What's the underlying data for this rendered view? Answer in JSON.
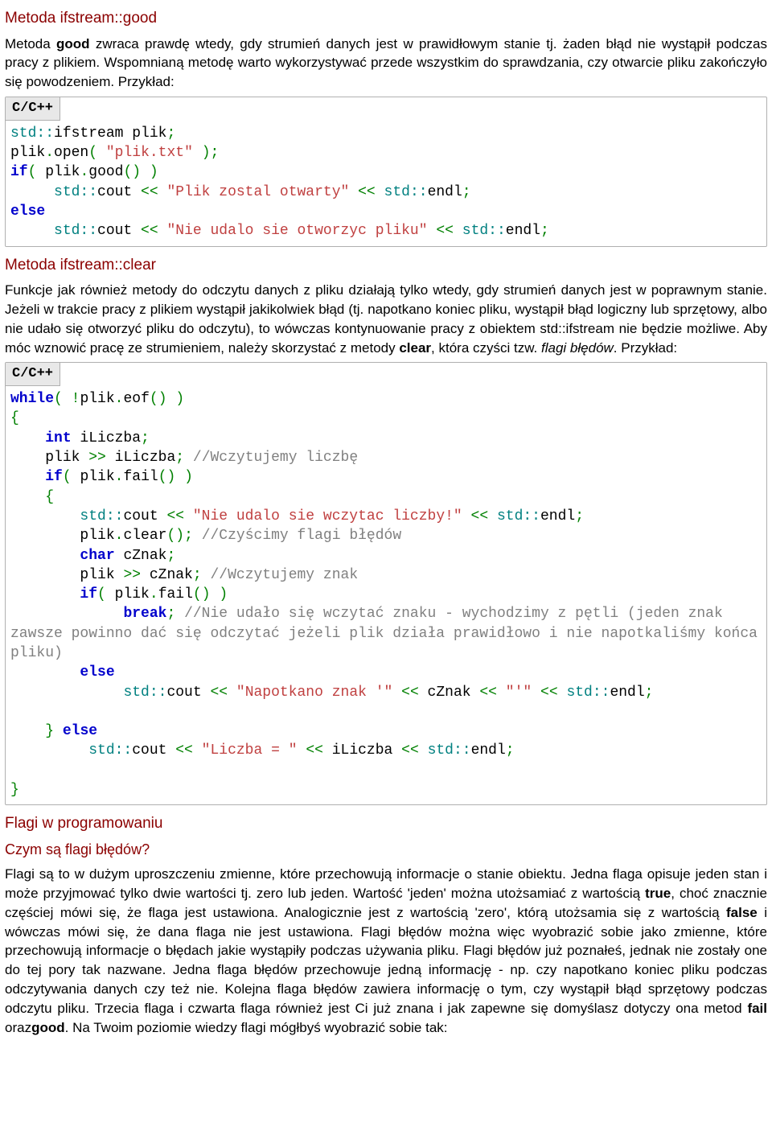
{
  "sections": {
    "good": {
      "heading": "Metoda ifstream::good",
      "para_pre": "Metoda ",
      "bold1": "good",
      "para_post": " zwraca prawdę wtedy, gdy strumień danych jest w prawidłowym stanie tj. żaden błąd nie wystąpił podczas pracy z plikiem. Wspomnianą metodę warto wykorzystywać przede wszystkim do sprawdzania, czy otwarcie pliku zakończyło się powodzeniem. Przykład:",
      "codelabel": "C/C++"
    },
    "clear": {
      "heading": "Metoda ifstream::clear",
      "para_pre": "Funkcje jak również metody do odczytu danych z pliku działają tylko wtedy, gdy strumień danych jest w poprawnym stanie. Jeżeli w trakcie pracy z plikiem wystąpił jakikolwiek błąd (tj. napotkano koniec pliku, wystąpił błąd logiczny lub sprzętowy, albo nie udało się otworzyć pliku do odczytu), to wówczas kontynuowanie pracy z obiektem std::ifstream nie będzie możliwe. Aby móc wznowić pracę ze strumieniem, należy skorzystać z metody ",
      "bold1": "clear",
      "para_mid": ", która czyści tzw. ",
      "ital1": "flagi błędów",
      "para_post": ". Przykład:",
      "codelabel": "C/C++"
    },
    "flags": {
      "heading1": "Flagi w programowaniu",
      "heading2": "Czym są flagi błędów?",
      "para_pre": "Flagi są to w dużym uproszczeniu zmienne, które przechowują informacje o stanie obiektu. Jedna flaga opisuje jeden stan i może przyjmować tylko dwie wartości tj. zero lub jeden. Wartość 'jeden' można utożsamiać z wartością ",
      "bold1": "true",
      "para_mid1": ", choć znacznie częściej mówi się, że flaga jest ustawiona. Analogicznie jest z wartością 'zero', którą utożsamia się z wartością ",
      "bold2": "false",
      "para_mid2": " i wówczas mówi się, że dana flaga nie jest ustawiona. Flagi błędów można więc wyobrazić sobie jako zmienne, które przechowują informacje o błędach jakie wystąpiły podczas używania pliku. Flagi błędów już poznałeś, jednak nie zostały one do tej pory tak nazwane. Jedna flaga błędów przechowuje jedną informację - np. czy napotkano koniec pliku podczas odczytywania danych czy też nie. Kolejna flaga błędów zawiera informację o tym, czy wystąpił błąd sprzętowy podczas odczytu pliku. Trzecia flaga i czwarta flaga również jest Ci już znana i jak zapewne się domyślasz dotyczy ona metod ",
      "bold3": "fail",
      "para_mid3": " oraz",
      "bold4": "good",
      "para_post": ". Na Twoim poziomie wiedzy flagi mógłbyś wyobrazić sobie tak:"
    }
  },
  "code1": {
    "l1_ns": "std",
    "l1_op1": "::",
    "l1_id1": "ifstream plik",
    "l1_p1": ";",
    "l2_id1": "plik",
    "l2_p1": ".",
    "l2_id2": "open",
    "l2_p2": "(",
    "l2_sp": " ",
    "l2_str": "\"plik.txt\"",
    "l2_sp2": " ",
    "l2_p3": ")",
    "l2_p4": ";",
    "l3_kw": "if",
    "l3_p1": "(",
    "l3_sp": " ",
    "l3_id1": "plik",
    "l3_p2": ".",
    "l3_id2": "good",
    "l3_p3": "()",
    "l3_sp2": " ",
    "l3_p4": ")",
    "l4_sp": "     ",
    "l4_ns": "std",
    "l4_op": "::",
    "l4_id1": "cout ",
    "l4_p1": "<<",
    "l4_sp2": " ",
    "l4_str": "\"Plik zostal otwarty\"",
    "l4_sp3": " ",
    "l4_p2": "<<",
    "l4_sp4": " ",
    "l4_ns2": "std",
    "l4_op2": "::",
    "l4_id2": "endl",
    "l4_p3": ";",
    "l5_kw": "else",
    "l6_sp": "     ",
    "l6_ns": "std",
    "l6_op": "::",
    "l6_id1": "cout ",
    "l6_p1": "<<",
    "l6_sp2": " ",
    "l6_str": "\"Nie udalo sie otworzyc pliku\"",
    "l6_sp3": " ",
    "l6_p2": "<<",
    "l6_sp4": " ",
    "l6_ns2": "std",
    "l6_op2": "::",
    "l6_id2": "endl",
    "l6_p3": ";"
  },
  "code2": {
    "l1_kw": "while",
    "l1_p1": "(",
    "l1_sp": " ",
    "l1_p2": "!",
    "l1_id1": "plik",
    "l1_p3": ".",
    "l1_id2": "eof",
    "l1_p4": "()",
    "l1_sp2": " ",
    "l1_p5": ")",
    "l2_p1": "{",
    "l3_sp": "    ",
    "l3_kw": "int",
    "l3_id": " iLiczba",
    "l3_p1": ";",
    "l4_sp": "    ",
    "l4_id1": "plik ",
    "l4_p1": ">>",
    "l4_id2": " iLiczba",
    "l4_p2": ";",
    "l4_sp2": " ",
    "l4_cm": "//Wczytujemy liczbę",
    "l5_sp": "    ",
    "l5_kw": "if",
    "l5_p1": "(",
    "l5_sp2": " ",
    "l5_id1": "plik",
    "l5_p2": ".",
    "l5_id2": "fail",
    "l5_p3": "()",
    "l5_sp3": " ",
    "l5_p4": ")",
    "l6_sp": "    ",
    "l6_p1": "{",
    "l7_sp": "        ",
    "l7_ns": "std",
    "l7_op": "::",
    "l7_id1": "cout ",
    "l7_p1": "<<",
    "l7_sp2": " ",
    "l7_str": "\"Nie udalo sie wczytac liczby!\"",
    "l7_sp3": " ",
    "l7_p2": "<<",
    "l7_sp4": " ",
    "l7_ns2": "std",
    "l7_op2": "::",
    "l7_id2": "endl",
    "l7_p3": ";",
    "l8_sp": "        ",
    "l8_id1": "plik",
    "l8_p1": ".",
    "l8_id2": "clear",
    "l8_p2": "()",
    "l8_p3": ";",
    "l8_sp2": " ",
    "l8_cm": "//Czyścimy flagi błędów",
    "l9_sp": "        ",
    "l9_kw": "char",
    "l9_id": " cZnak",
    "l9_p1": ";",
    "l10_sp": "        ",
    "l10_id1": "plik ",
    "l10_p1": ">>",
    "l10_id2": " cZnak",
    "l10_p2": ";",
    "l10_sp2": " ",
    "l10_cm": "//Wczytujemy znak",
    "l11_sp": "        ",
    "l11_kw": "if",
    "l11_p1": "(",
    "l11_sp2": " ",
    "l11_id1": "plik",
    "l11_p2": ".",
    "l11_id2": "fail",
    "l11_p3": "()",
    "l11_sp3": " ",
    "l11_p4": ")",
    "l12_sp": "             ",
    "l12_kw": "break",
    "l12_p1": ";",
    "l12_sp2": " ",
    "l12_cm": "//Nie udało się wczytać znaku - wychodzimy z pętli (jeden znak zawsze powinno dać się odczytać jeżeli plik działa prawidłowo i nie napotkaliśmy końca pliku)",
    "l13_sp": "        ",
    "l13_kw": "else",
    "l14_sp": "             ",
    "l14_ns": "std",
    "l14_op": "::",
    "l14_id1": "cout ",
    "l14_p1": "<<",
    "l14_sp2": " ",
    "l14_str": "\"Napotkano znak '\"",
    "l14_sp3": " ",
    "l14_p2": "<<",
    "l14_id2": " cZnak ",
    "l14_p3": "<<",
    "l14_sp4": " ",
    "l14_str2": "\"'\"",
    "l14_sp5": " ",
    "l14_p4": "<<",
    "l14_sp6": " ",
    "l14_ns2": "std",
    "l14_op2": "::",
    "l14_id3": "endl",
    "l14_p5": ";",
    "l15_sp": "       ",
    "l16_sp": "    ",
    "l16_p1": "}",
    "l16_sp2": " ",
    "l16_kw": "else",
    "l17_sp": "         ",
    "l17_ns": "std",
    "l17_op": "::",
    "l17_id1": "cout ",
    "l17_p1": "<<",
    "l17_sp2": " ",
    "l17_str": "\"Liczba = \"",
    "l17_sp3": " ",
    "l17_p2": "<<",
    "l17_id2": " iLiczba ",
    "l17_p3": "<<",
    "l17_sp4": " ",
    "l17_ns2": "std",
    "l17_op2": "::",
    "l17_id3": "endl",
    "l17_p4": ";",
    "l18_sp": "   ",
    "l19_p1": "}"
  }
}
